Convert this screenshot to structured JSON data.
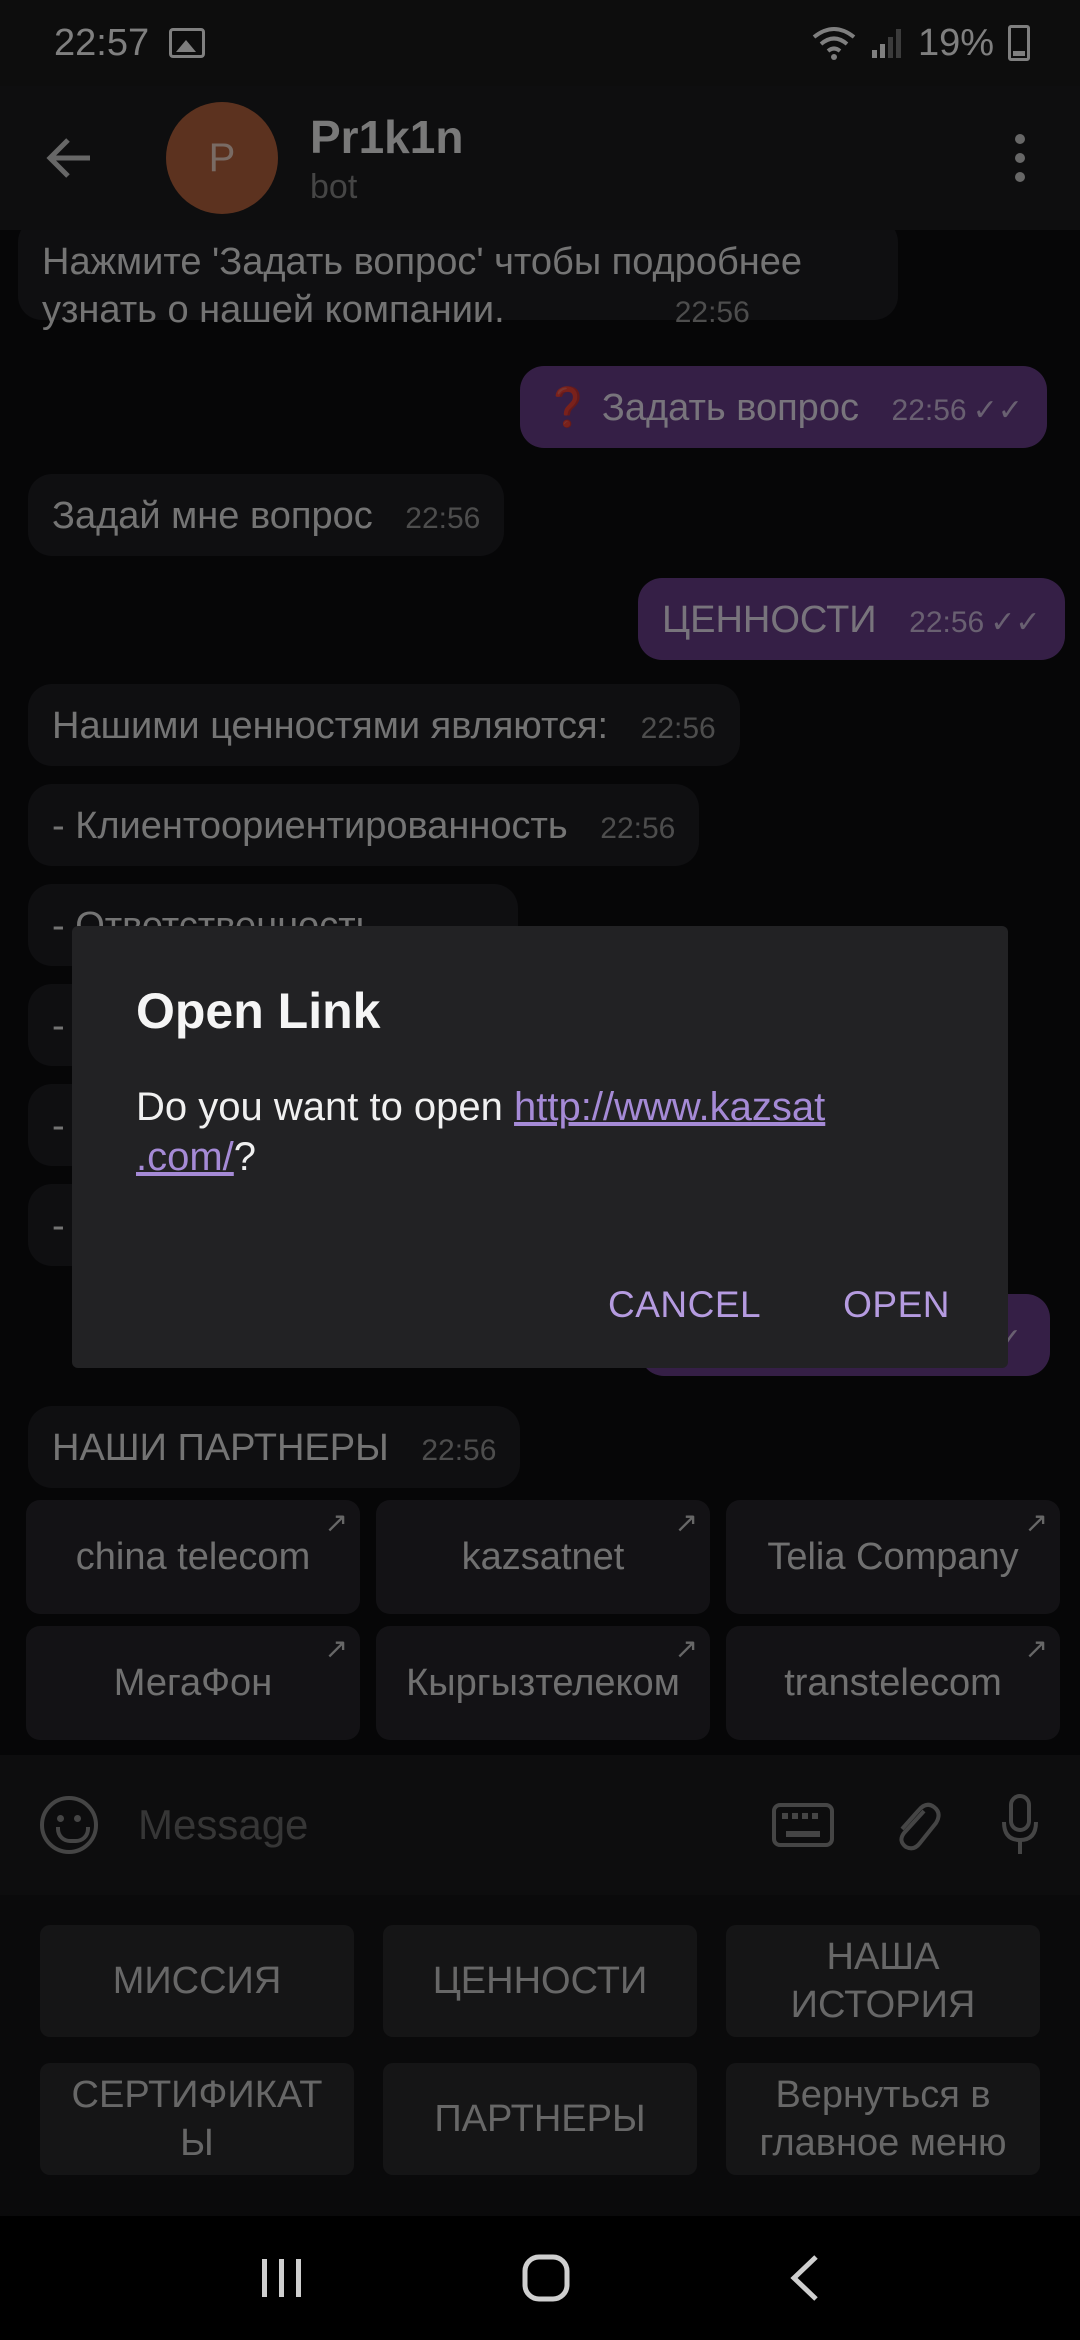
{
  "status_bar": {
    "time": "22:57",
    "battery": "19%"
  },
  "header": {
    "name": "Pr1k1n",
    "subtitle": "bot",
    "avatar_letter": "P"
  },
  "messages": {
    "m1_line1": "Нажмите 'Задать вопрос' чтобы подробнее",
    "m1_line2": "узнать о нашей компании.",
    "m1_time": "22:56",
    "m2_icon": "❓",
    "m2_text": "Задать вопрос",
    "m2_time": "22:56",
    "m3_text": "Задай мне вопрос",
    "m3_time": "22:56",
    "m4_text": "ЦЕННОСТИ",
    "m4_time": "22:56",
    "m5_text": "Нашими ценностями являются:",
    "m5_time": "22:56",
    "m6_text": "- Клиентоориентированность",
    "m6_time": "22:56",
    "m7_text": "- Ответственность",
    "m8_text": "-",
    "m9_text": "-",
    "m10_text": "-",
    "m11_text": "НАШИ ПАРТНЕРЫ",
    "m11_time": "22:56"
  },
  "partners": [
    "china telecom",
    "kazsatnet",
    "Telia Company",
    "МегаФон",
    "Кыргызтелеком",
    "transtelecom"
  ],
  "input": {
    "placeholder": "Message"
  },
  "reply_keyboard": {
    "b1": "МИССИЯ",
    "b2": "ЦЕННОСТИ",
    "b3_l1": "НАША",
    "b3_l2": "ИСТОРИЯ",
    "b4_l1": "СЕРТИФИКАТ",
    "b4_l2": "Ы",
    "b5": "ПАРТНЕРЫ",
    "b6_l1": "Вернуться в",
    "b6_l2": "главное меню"
  },
  "dialog": {
    "title": "Open Link",
    "prompt": "Do you want to open ",
    "link_l1": "http://www.kazsat",
    "link_l2": ".com/",
    "suffix": "?",
    "cancel": "CANCEL",
    "open": "OPEN"
  },
  "colors": {
    "accent": "#b59be0",
    "outgoing_bubble": "#6a3f8c",
    "avatar": "#b8643e"
  }
}
